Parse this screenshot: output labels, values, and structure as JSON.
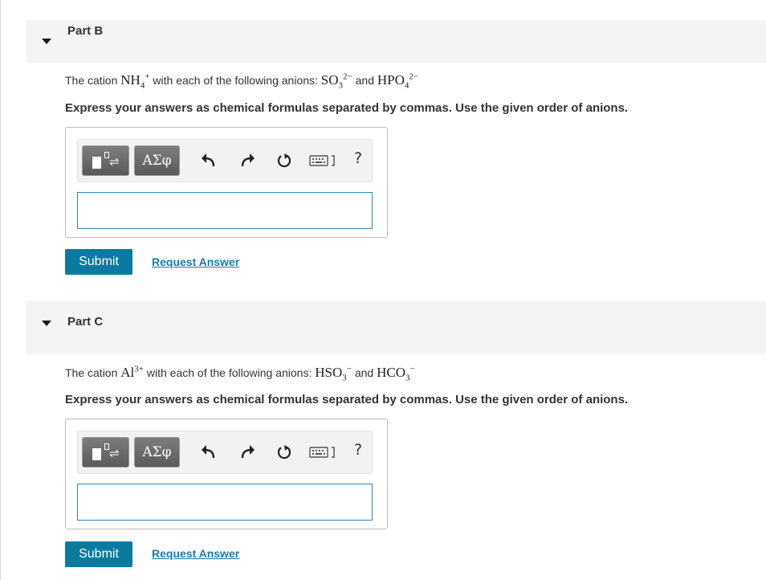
{
  "parts": [
    {
      "title": "Part B",
      "question": {
        "prefix": "The cation ",
        "cation_base": "NH",
        "cation_sub": "4",
        "cation_sup": "+",
        "middle": " with each of the following anions: ",
        "anion1_base": "SO",
        "anion1_sub": "3",
        "anion1_sup": "2−",
        "conj": " and ",
        "anion2_base": "HPO",
        "anion2_sub": "4",
        "anion2_sup": "2−"
      },
      "instruction": "Express your answers as chemical formulas separated by commas. Use the given order of anions.",
      "greek_label": "ΑΣφ",
      "help_label": "?",
      "answer_value": "",
      "submit_label": "Submit",
      "request_label": "Request Answer"
    },
    {
      "title": "Part C",
      "question": {
        "prefix": "The cation ",
        "cation_base": "Al",
        "cation_sub": "",
        "cation_sup": "3+",
        "middle": " with each of the following anions: ",
        "anion1_base": "HSO",
        "anion1_sub": "3",
        "anion1_sup": "−",
        "conj": " and ",
        "anion2_base": "HCO",
        "anion2_sub": "3",
        "anion2_sup": "−"
      },
      "instruction": "Express your answers as chemical formulas separated by commas. Use the given order of anions.",
      "greek_label": "ΑΣφ",
      "help_label": "?",
      "answer_value": "",
      "submit_label": "Submit",
      "request_label": "Request Answer"
    }
  ],
  "colors": {
    "submit_bg": "#0b7aa0",
    "link": "#1b7ab0",
    "input_border": "#2d86b6",
    "header_bg": "#f4f4f4"
  },
  "icons": [
    "caret-down-icon",
    "template-icon",
    "undo-icon",
    "redo-icon",
    "reset-icon",
    "keyboard-icon",
    "help-icon"
  ]
}
